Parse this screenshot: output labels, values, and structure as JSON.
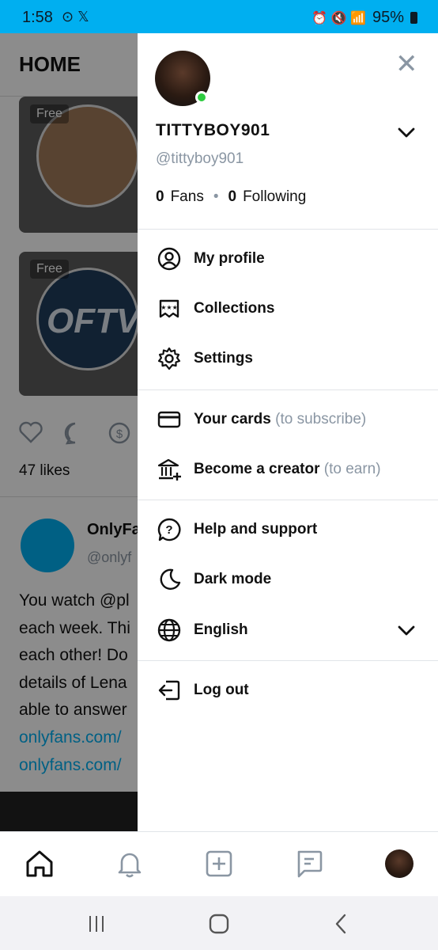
{
  "status_bar": {
    "time": "1:58",
    "battery": "95%",
    "left_icons": "⊙ 𝕏",
    "right_icons": "⏰ 🔇 📶"
  },
  "feed": {
    "title": "HOME",
    "cards": [
      {
        "badge": "Free"
      },
      {
        "badge": "Free",
        "logo_text": "OFTV"
      }
    ],
    "likes": "47 likes",
    "post_author": "OnlyFa",
    "post_handle": "@onlyf",
    "post_text_lines": [
      "You watch @pl",
      "each week. Thi",
      "each other! Do",
      "details of Lena",
      "able to answer",
      "onlyfans.com/",
      "onlyfans.com/"
    ]
  },
  "drawer": {
    "username": "TITTYBOY901",
    "handle": "@tittyboy901",
    "fans_count": "0",
    "fans_label": "Fans",
    "following_count": "0",
    "following_label": "Following",
    "menu": {
      "my_profile": "My profile",
      "collections": "Collections",
      "settings": "Settings",
      "your_cards": "Your cards",
      "your_cards_hint": "(to subscribe)",
      "become_creator": "Become a creator",
      "become_creator_hint": "(to earn)",
      "help": "Help and support",
      "dark_mode": "Dark mode",
      "language": "English",
      "logout": "Log out"
    }
  },
  "colors": {
    "accent": "#00aff0",
    "muted": "#8a96a3",
    "online": "#2ecc40"
  }
}
